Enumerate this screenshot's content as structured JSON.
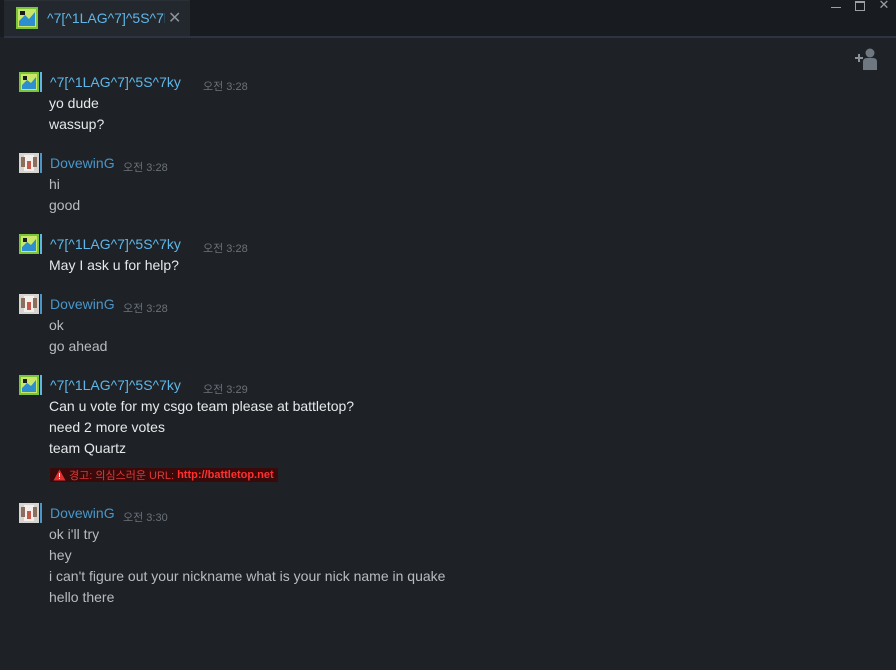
{
  "window": {
    "tab_title": "^7[^1LAG^7]^5S^7ky",
    "tab_close": "✕",
    "controls": [
      "minimize",
      "maximize",
      "close"
    ],
    "close_glyph": "✕"
  },
  "colors": {
    "friend_name": "#5fb6e6",
    "self_name": "#4a96c8",
    "friend_text": "#e6e8ea",
    "self_text": "#b8bcc1",
    "warning": "#d93b3b",
    "background": "#1e2227"
  },
  "icons": {
    "add_friend": "add-friend-icon",
    "warning": "warning-triangle-icon"
  },
  "messages": [
    {
      "sender": "^7[^1LAG^7]^5S^7ky",
      "time": "오전 3:28",
      "lines": [
        "yo dude",
        "wassup?"
      ]
    },
    {
      "sender": "DovewinG",
      "time": "오전 3:28",
      "lines": [
        "hi",
        "good"
      ]
    },
    {
      "sender": "^7[^1LAG^7]^5S^7ky",
      "time": "오전 3:28",
      "lines": [
        "May I ask u for help?"
      ]
    },
    {
      "sender": "DovewinG",
      "time": "오전 3:28",
      "lines": [
        "ok",
        "go ahead"
      ]
    },
    {
      "sender": "^7[^1LAG^7]^5S^7ky",
      "time": "오전 3:29",
      "lines": [
        "Can u vote for my csgo team please at battletop?",
        "need 2 more votes",
        "team Quartz"
      ],
      "warning": {
        "label": "경고: 의심스러운 URL:",
        "url": "http://battletop.net"
      }
    },
    {
      "sender": "DovewinG",
      "time": "오전 3:30",
      "lines": [
        "ok i'll try",
        "hey",
        "i can't figure out your nickname what is your nick name in quake",
        "hello there"
      ]
    }
  ]
}
